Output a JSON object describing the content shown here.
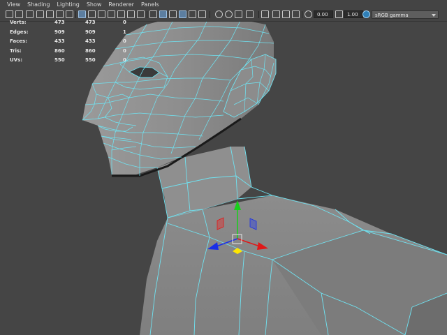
{
  "menu": {
    "view": "View",
    "shading": "Shading",
    "lighting": "Lighting",
    "show": "Show",
    "renderer": "Renderer",
    "panels": "Panels"
  },
  "toolbar": {
    "exposure_value": "0.00",
    "gamma_value": "1.00",
    "color_space": "sRGB gamma",
    "icons": [
      "select-camera-icon",
      "camera-attributes-icon",
      "bookmark-icon",
      "image-plane-icon",
      "grid-icon",
      "film-gate-icon",
      "resolution-gate-icon",
      "gate-mask-icon",
      "field-chart-icon",
      "safe-action-icon",
      "safe-title-icon",
      "wireframe-icon",
      "smooth-shade-icon",
      "default-material-icon",
      "wireframe-on-shaded-icon",
      "textured-icon",
      "use-all-lights-icon",
      "shadows-icon",
      "screen-space-ao-icon",
      "motion-blur-icon",
      "anti-aliasing-icon",
      "depth-of-field-icon",
      "isolate-select-icon",
      "xray-icon",
      "xray-active-components-icon",
      "xray-joints-icon",
      "exposure-icon",
      "gamma-icon",
      "color-management-icon"
    ],
    "accent": "#5c7ea0"
  },
  "hud": {
    "rows": [
      {
        "label": "Verts:",
        "v1": "473",
        "v2": "473",
        "v3": "0"
      },
      {
        "label": "Edges:",
        "v1": "909",
        "v2": "909",
        "v3": "1"
      },
      {
        "label": "Faces:",
        "v1": "433",
        "v2": "433",
        "v3": "0"
      },
      {
        "label": "Tris:",
        "v1": "860",
        "v2": "860",
        "v3": "0"
      },
      {
        "label": "UVs:",
        "v1": "550",
        "v2": "550",
        "v3": "0"
      }
    ]
  },
  "colors": {
    "wireframe": "#6fe3f2",
    "surface": "#8a8a8a",
    "background": "#454545",
    "axis_x": "#e01818",
    "axis_y": "#18d01a",
    "axis_z": "#1a2fe8",
    "center": "#ffe600"
  }
}
